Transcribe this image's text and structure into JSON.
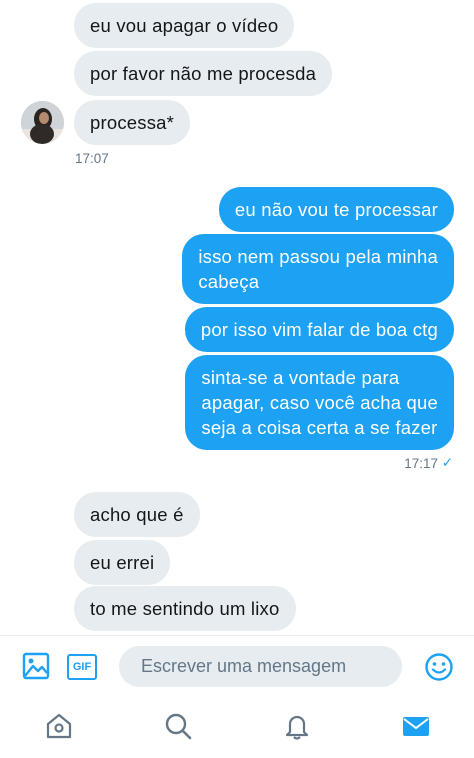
{
  "conversation": {
    "incoming_group_1": [
      "eu vou apagar o vídeo",
      "por favor não me procesda",
      "processa*"
    ],
    "incoming_time_1": "17:07",
    "outgoing_group": [
      "eu não vou te processar",
      "isso nem passou pela minha\ncabeça",
      "por isso vim falar de boa ctg",
      "sinta-se a vontade para\napagar, caso você acha que\nseja a coisa certa a se fazer"
    ],
    "outgoing_time": "17:17",
    "outgoing_status": "✓",
    "incoming_group_2": [
      "acho que é",
      "eu errei",
      "to me sentindo um lixo"
    ]
  },
  "composer": {
    "gif_label": "GIF",
    "placeholder": "Escrever uma mensagem"
  },
  "icons": {
    "image": "image-icon",
    "gif": "gif-icon",
    "emoji": "emoji-icon",
    "home": "home-icon",
    "search": "search-icon",
    "notifications": "bell-icon",
    "messages": "mail-icon"
  },
  "colors": {
    "accent": "#1da1f2",
    "incoming_bubble": "#e6ecf0",
    "muted_text": "#657786"
  }
}
